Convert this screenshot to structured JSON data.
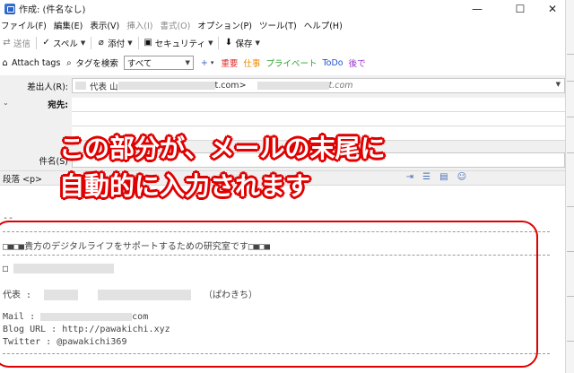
{
  "window": {
    "title": "作成: (件名なし)",
    "minimize": "—",
    "maximize": "☐",
    "close": "✕"
  },
  "menu": [
    "ファイル(F)",
    "編集(E)",
    "表示(V)",
    "挿入(I)",
    "書式(O)",
    "オプション(P)",
    "ツール(T)",
    "ヘルプ(H)"
  ],
  "menu_disabled": [
    false,
    false,
    false,
    true,
    true,
    false,
    false,
    false
  ],
  "toolbar": {
    "send": "送信",
    "spell": "スペル",
    "attach": "添付",
    "security": "セキュリティ",
    "save": "保存"
  },
  "toolbar2": {
    "attach_tags": "Attach tags",
    "tag_search": "タグを検索",
    "filter_value": "すべて",
    "tags": [
      {
        "label": "重要",
        "color": "#e03030"
      },
      {
        "label": "仕事",
        "color": "#f08a00"
      },
      {
        "label": "プライベート",
        "color": "#2ea02e"
      },
      {
        "label": "ToDo",
        "color": "#2255cc"
      },
      {
        "label": "後で",
        "color": "#9933cc"
      }
    ]
  },
  "header": {
    "from_label": "差出人(R):",
    "from_value_prefix": "代表 山",
    "from_value_mid": "t.com>",
    "from_value_suffix": "t.com",
    "to_label": "宛先:",
    "subject_label": "件名(S)"
  },
  "format": {
    "paragraph": "段落 <p>"
  },
  "body": {
    "sig_sep": "--",
    "tagline": "□■□■貴方のデジタルライフをサポートするための研究室です□■□■",
    "lab_prefix": "□",
    "rep_label": "代表 :",
    "rep_reading": "（ぱわきち）",
    "mail": "Mail : ",
    "mail_suffix": "com",
    "blog": "Blog URL : http://pawakichi.xyz",
    "twitter": "Twitter : @pawakichi369"
  },
  "annotation": {
    "line1": "この部分が、メールの末尾に",
    "line2": "自動的に入力されます",
    "color": "#e00000"
  }
}
